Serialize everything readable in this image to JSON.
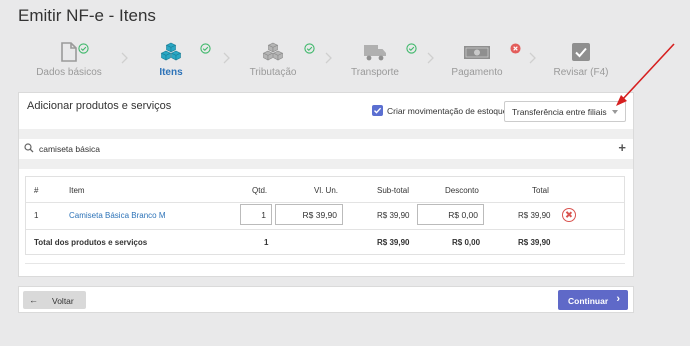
{
  "page": {
    "title": "Emitir NF-e - Itens"
  },
  "steps": [
    {
      "label": "Dados básicos",
      "status": "done",
      "icon": "document-icon"
    },
    {
      "label": "Itens",
      "status": "done",
      "active": true,
      "icon": "boxes-icon"
    },
    {
      "label": "Tributação",
      "status": "done",
      "icon": "boxes-icon"
    },
    {
      "label": "Transporte",
      "status": "done",
      "icon": "truck-icon"
    },
    {
      "label": "Pagamento",
      "status": "error",
      "icon": "money-icon"
    },
    {
      "label": "Revisar (F4)",
      "status": "pending",
      "icon": "checkbox-icon"
    }
  ],
  "add_section": {
    "title": "Adicionar produtos e serviços",
    "stock_checkbox_label": "Criar movimentação de estoque",
    "stock_checkbox_checked": true,
    "movement_type_selected": "Transferência entre filiais"
  },
  "search": {
    "value": "camiseta básica",
    "add_symbol": "+"
  },
  "table": {
    "headers": {
      "num": "#",
      "item": "Item",
      "qty": "Qtd.",
      "unit_price": "Vl. Un.",
      "subtotal": "Sub-total",
      "discount": "Desconto",
      "total": "Total"
    },
    "rows": [
      {
        "num": "1",
        "item": "Camiseta Básica Branco M",
        "qty": "1",
        "unit_price": "R$ 39,90",
        "subtotal": "R$ 39,90",
        "discount": "R$ 0,00",
        "total": "R$ 39,90"
      }
    ],
    "footer": {
      "label": "Total dos produtos e serviços",
      "qty": "1",
      "subtotal": "R$ 39,90",
      "discount": "R$ 0,00",
      "total": "R$ 39,90"
    }
  },
  "actions": {
    "back_label": "Voltar",
    "continue_label": "Continuar"
  },
  "colors": {
    "accent": "#5f69c8",
    "link": "#2d73b8",
    "success": "#3fb86b",
    "error": "#e35d5b",
    "annotation": "#d61f1f"
  }
}
